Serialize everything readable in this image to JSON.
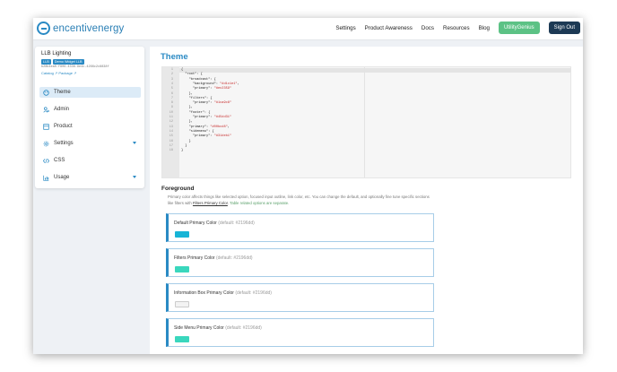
{
  "brand": {
    "logo_text": "encentivenergy",
    "accent": "#2a8ac4"
  },
  "nav": {
    "links": [
      "Settings",
      "Product Awareness",
      "Docs",
      "Resources",
      "Blog"
    ],
    "utility_button": "UtilityGenius",
    "sign_out": "Sign Out"
  },
  "sidebar": {
    "org_name": "LLB Lighting",
    "badge_llb": "LLB",
    "badge_demo": "Demo Widget LLB",
    "org_id": "b28b4ea0-f806-4336-9e4c-4266c2c8838f",
    "org_links": "Catalog ↗  Package ↗",
    "items": [
      {
        "label": "Theme",
        "icon": "palette-icon"
      },
      {
        "label": "Admin",
        "icon": "admin-icon"
      },
      {
        "label": "Product",
        "icon": "product-icon"
      },
      {
        "label": "Settings",
        "icon": "gear-icon"
      },
      {
        "label": "CSS",
        "icon": "code-icon"
      },
      {
        "label": "Usage",
        "icon": "chart-icon"
      }
    ]
  },
  "main": {
    "title": "Theme",
    "editor": {
      "line_numbers": [
        "1",
        "2",
        "3",
        "4",
        "5",
        "6",
        "7",
        "8",
        "9",
        "10",
        "11",
        "12",
        "13",
        "14",
        "15",
        "16",
        "17",
        "18"
      ],
      "lines": [
        [
          {
            "t": "{"
          }
        ],
        [
          {
            "t": "  \"root\": {"
          }
        ],
        [
          {
            "t": "    \"broadcast\": {"
          }
        ],
        [
          {
            "t": "      \"background\": "
          },
          {
            "t": "\"#d1c1e1\"",
            "s": true
          },
          {
            "t": ","
          }
        ],
        [
          {
            "t": "      \"primary\": "
          },
          {
            "t": "\"#ec2359\"",
            "s": true
          }
        ],
        [
          {
            "t": "    },"
          }
        ],
        [
          {
            "t": "    \"filters\": {"
          }
        ],
        [
          {
            "t": "      \"primary\": "
          },
          {
            "t": "\"#1ca9c8\"",
            "s": true
          }
        ],
        [
          {
            "t": "    },"
          }
        ],
        [
          {
            "t": "    \"footer\": {"
          }
        ],
        [
          {
            "t": "      \"primary\": "
          },
          {
            "t": "\"#45dd31\"",
            "s": true
          }
        ],
        [
          {
            "t": "    },"
          }
        ],
        [
          {
            "t": "    \"primary\": "
          },
          {
            "t": "\"#00bcd8\"",
            "s": true
          },
          {
            "t": ","
          }
        ],
        [
          {
            "t": "    \"sidemenu\": {"
          }
        ],
        [
          {
            "t": "      \"primary\": "
          },
          {
            "t": "\"#31deb1\"",
            "s": true
          }
        ],
        [
          {
            "t": "    }"
          }
        ],
        [
          {
            "t": "  }"
          }
        ],
        [
          {
            "t": "}"
          }
        ]
      ]
    },
    "foreground": {
      "heading": "Foreground",
      "desc_part1": "Primary color affects things like selected option, focused input outline, link color, etc. You can change the default, and optionally fine tune specific sections like filters with ",
      "desc_link": "Filters Primary Color",
      "desc_part2": ". ",
      "desc_note": "Table related options are separate.",
      "cards": [
        {
          "label": "Default Primary Color",
          "default": "(default: #2196dd)",
          "color": "#17b4d6"
        },
        {
          "label": "Filters Primary Color",
          "default": "(default: #2196dd)",
          "color": "#3ad7bd"
        },
        {
          "label": "Information Box Primary Color",
          "default": "(default: #2196dd)",
          "color": "#f3f3f3"
        },
        {
          "label": "Side Menu Primary Color",
          "default": "(default: #2196dd)",
          "color": "#3ad7bd"
        }
      ]
    }
  }
}
